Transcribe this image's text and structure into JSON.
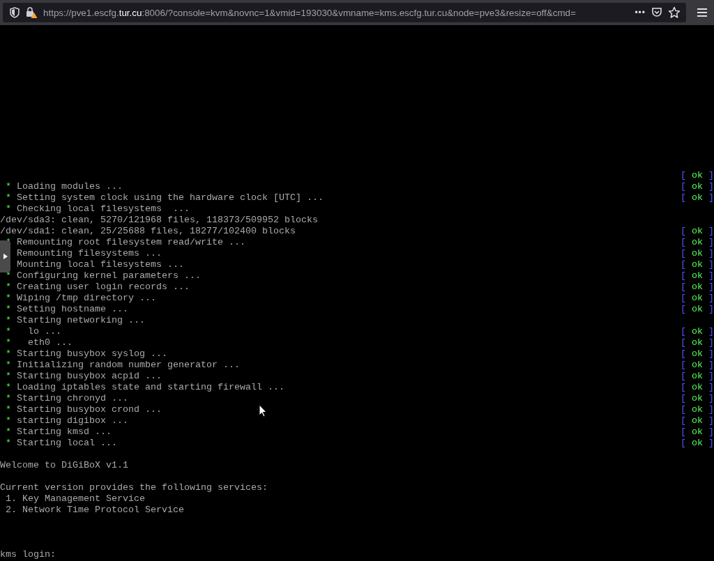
{
  "browser": {
    "url": {
      "before": "https://pve1.escfg.",
      "domain": "tur.cu",
      "after": ":8006/?console=kvm&novnc=1&vmid=193030&vmname=kms.escfg.tur.cu&node=pve3&resize=off&cmd="
    },
    "page_actions": "•••"
  },
  "console": {
    "lines": [
      {
        "kind": "status-only",
        "status": {
          "open": "[",
          "text": "ok",
          "close": "]"
        }
      },
      {
        "kind": "bullet",
        "bullet": "*",
        "text": "Loading modules ...",
        "status": {
          "open": "[",
          "text": "ok",
          "close": "]"
        }
      },
      {
        "kind": "bullet",
        "bullet": "*",
        "text": "Setting system clock using the hardware clock [UTC] ...",
        "status": {
          "open": "[",
          "text": "ok",
          "close": "]"
        }
      },
      {
        "kind": "bullet",
        "bullet": "*",
        "text": "Checking local filesystems  ..."
      },
      {
        "kind": "plain",
        "text": "/dev/sda3: clean, 5270/121968 files, 118373/509952 blocks"
      },
      {
        "kind": "plain",
        "text": "/dev/sda1: clean, 25/25688 files, 18277/102400 blocks",
        "status": {
          "open": "[",
          "text": "ok",
          "close": "]"
        }
      },
      {
        "kind": "bullet",
        "bullet": "*",
        "text": "Remounting root filesystem read/write ...",
        "status": {
          "open": "[",
          "text": "ok",
          "close": "]"
        }
      },
      {
        "kind": "indent",
        "text": "Remounting filesystems ...",
        "status": {
          "open": "[",
          "text": "ok",
          "close": "]"
        }
      },
      {
        "kind": "indent",
        "text": "Mounting local filesystems ...",
        "status": {
          "open": "[",
          "text": "ok",
          "close": "]"
        }
      },
      {
        "kind": "bullet",
        "bullet": "*",
        "text": "Configuring kernel parameters ...",
        "status": {
          "open": "[",
          "text": "ok",
          "close": "]"
        }
      },
      {
        "kind": "bullet",
        "bullet": "*",
        "text": "Creating user login records ...",
        "status": {
          "open": "[",
          "text": "ok",
          "close": "]"
        }
      },
      {
        "kind": "bullet",
        "bullet": "*",
        "text": "Wiping /tmp directory ...",
        "status": {
          "open": "[",
          "text": "ok",
          "close": "]"
        }
      },
      {
        "kind": "bullet",
        "bullet": "*",
        "text": "Setting hostname ...",
        "status": {
          "open": "[",
          "text": "ok",
          "close": "]"
        }
      },
      {
        "kind": "bullet",
        "bullet": "*",
        "text": "Starting networking ..."
      },
      {
        "kind": "bullet",
        "bullet": "*",
        "text": "  lo ...",
        "status": {
          "open": "[",
          "text": "ok",
          "close": "]"
        }
      },
      {
        "kind": "bullet",
        "bullet": "*",
        "text": "  eth0 ...",
        "status": {
          "open": "[",
          "text": "ok",
          "close": "]"
        }
      },
      {
        "kind": "bullet",
        "bullet": "*",
        "text": "Starting busybox syslog ...",
        "status": {
          "open": "[",
          "text": "ok",
          "close": "]"
        }
      },
      {
        "kind": "bullet",
        "bullet": "*",
        "text": "Initializing random number generator ...",
        "status": {
          "open": "[",
          "text": "ok",
          "close": "]"
        }
      },
      {
        "kind": "bullet",
        "bullet": "*",
        "text": "Starting busybox acpid ...",
        "status": {
          "open": "[",
          "text": "ok",
          "close": "]"
        }
      },
      {
        "kind": "bullet",
        "bullet": "*",
        "text": "Loading iptables state and starting firewall ...",
        "status": {
          "open": "[",
          "text": "ok",
          "close": "]"
        }
      },
      {
        "kind": "bullet",
        "bullet": "*",
        "text": "Starting chronyd ...",
        "status": {
          "open": "[",
          "text": "ok",
          "close": "]"
        }
      },
      {
        "kind": "bullet",
        "bullet": "*",
        "text": "Starting busybox crond ...",
        "status": {
          "open": "[",
          "text": "ok",
          "close": "]"
        }
      },
      {
        "kind": "bullet",
        "bullet": "*",
        "text": "starting digibox ...",
        "status": {
          "open": "[",
          "text": "ok",
          "close": "]"
        }
      },
      {
        "kind": "bullet",
        "bullet": "*",
        "text": "Starting kmsd ...",
        "status": {
          "open": "[",
          "text": "ok",
          "close": "]"
        }
      },
      {
        "kind": "bullet",
        "bullet": "*",
        "text": "Starting local ...",
        "status": {
          "open": "[",
          "text": "ok",
          "close": "]"
        }
      },
      {
        "kind": "blank"
      },
      {
        "kind": "plain",
        "text": "Welcome to DiGiBoX v1.1"
      },
      {
        "kind": "blank"
      },
      {
        "kind": "plain",
        "text": "Current version provides the following services:"
      },
      {
        "kind": "plain",
        "text": " 1. Key Management Service"
      },
      {
        "kind": "plain",
        "text": " 2. Network Time Protocol Service"
      },
      {
        "kind": "blank"
      },
      {
        "kind": "blank"
      },
      {
        "kind": "blank"
      },
      {
        "kind": "plain",
        "text": "kms login:"
      }
    ]
  }
}
